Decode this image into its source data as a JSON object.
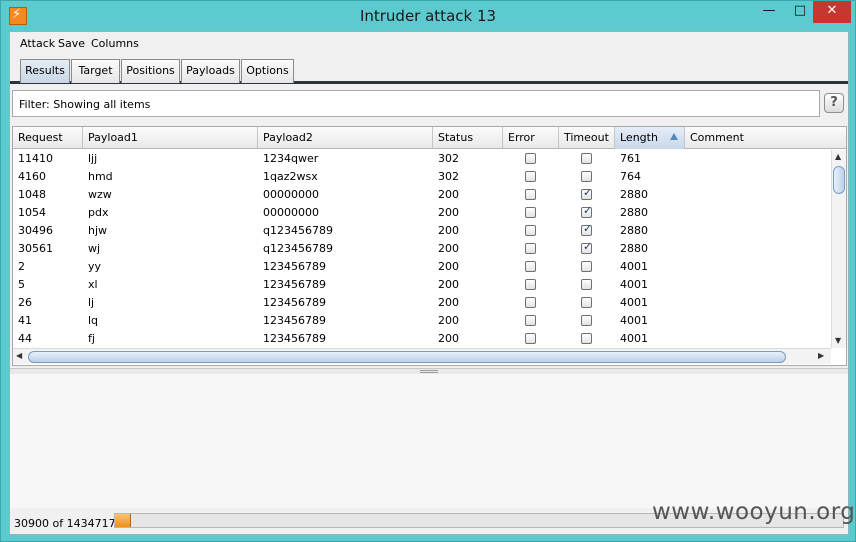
{
  "window": {
    "title": "Intruder attack 13",
    "minimize_glyph": "—",
    "maximize_glyph": "□",
    "close_glyph": "✕"
  },
  "menu": [
    "Attack",
    "Save",
    "Columns"
  ],
  "tabs": [
    "Results",
    "Target",
    "Positions",
    "Payloads",
    "Options"
  ],
  "active_tab": "Results",
  "filter": {
    "label": "Filter:",
    "value": "Showing all items",
    "help_glyph": "?"
  },
  "table": {
    "columns": [
      "Request",
      "Payload1",
      "Payload2",
      "Status",
      "Error",
      "Timeout",
      "Length",
      "Comment"
    ],
    "sorted_column": "Length",
    "rows": [
      {
        "request": "11410",
        "payload1": "ljj",
        "payload2": "1234qwer",
        "status": "302",
        "error": false,
        "timeout": false,
        "length": "761",
        "comment": ""
      },
      {
        "request": "4160",
        "payload1": "hmd",
        "payload2": "1qaz2wsx",
        "status": "302",
        "error": false,
        "timeout": false,
        "length": "764",
        "comment": ""
      },
      {
        "request": "1048",
        "payload1": "wzw",
        "payload2": "00000000",
        "status": "200",
        "error": false,
        "timeout": true,
        "length": "2880",
        "comment": ""
      },
      {
        "request": "1054",
        "payload1": "pdx",
        "payload2": "00000000",
        "status": "200",
        "error": false,
        "timeout": true,
        "length": "2880",
        "comment": ""
      },
      {
        "request": "30496",
        "payload1": "hjw",
        "payload2": "q123456789",
        "status": "200",
        "error": false,
        "timeout": true,
        "length": "2880",
        "comment": ""
      },
      {
        "request": "30561",
        "payload1": "wj",
        "payload2": "q123456789",
        "status": "200",
        "error": false,
        "timeout": true,
        "length": "2880",
        "comment": ""
      },
      {
        "request": "2",
        "payload1": "yy",
        "payload2": "123456789",
        "status": "200",
        "error": false,
        "timeout": false,
        "length": "4001",
        "comment": ""
      },
      {
        "request": "5",
        "payload1": "xl",
        "payload2": "123456789",
        "status": "200",
        "error": false,
        "timeout": false,
        "length": "4001",
        "comment": ""
      },
      {
        "request": "26",
        "payload1": "lj",
        "payload2": "123456789",
        "status": "200",
        "error": false,
        "timeout": false,
        "length": "4001",
        "comment": ""
      },
      {
        "request": "41",
        "payload1": "lq",
        "payload2": "123456789",
        "status": "200",
        "error": false,
        "timeout": false,
        "length": "4001",
        "comment": ""
      },
      {
        "request": "44",
        "payload1": "fj",
        "payload2": "123456789",
        "status": "200",
        "error": false,
        "timeout": false,
        "length": "4001",
        "comment": ""
      }
    ]
  },
  "status_bar": {
    "progress_text": "30900 of 1434717",
    "progress_fraction": 0.0215
  },
  "watermark": "www.wooyun.org",
  "colors": {
    "title_bar": "#5ccbcf",
    "close_button": "#c7372f",
    "progress_fill": "#f08f18",
    "app_icon": "#f28b1e"
  }
}
